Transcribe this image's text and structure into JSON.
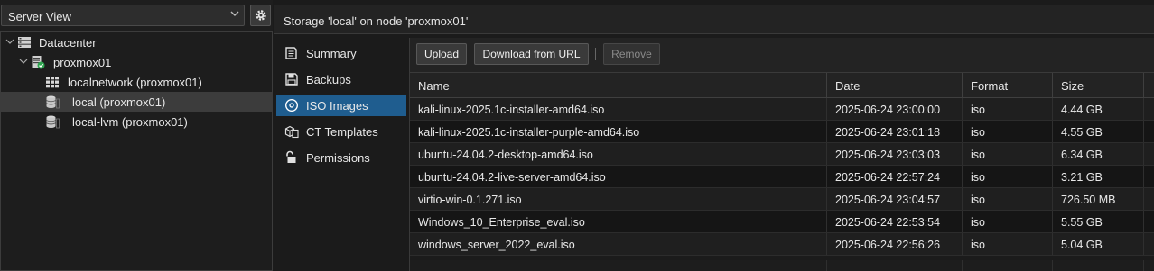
{
  "colors": {
    "accent": "#1f5d8f",
    "status_ok": "#2ea44f"
  },
  "view_selector": {
    "value": "Server View",
    "icon": "chevron-down-icon"
  },
  "gear": {
    "icon": "gear-icon"
  },
  "tree": [
    {
      "label": "Datacenter",
      "icon": "datacenter-icon"
    },
    {
      "label": "proxmox01",
      "icon": "server-online-icon"
    },
    {
      "label": "localnetwork (proxmox01)",
      "icon": "network-grid-icon"
    },
    {
      "label": "local (proxmox01)",
      "icon": "storage-icon",
      "selected": true
    },
    {
      "label": "local-lvm (proxmox01)",
      "icon": "storage-icon"
    }
  ],
  "panel_title": "Storage 'local' on node 'proxmox01'",
  "nav": [
    {
      "label": "Summary",
      "icon": "book-icon"
    },
    {
      "label": "Backups",
      "icon": "floppy-icon"
    },
    {
      "label": "ISO Images",
      "icon": "disc-icon",
      "active": true
    },
    {
      "label": "CT Templates",
      "icon": "cube-file-icon"
    },
    {
      "label": "Permissions",
      "icon": "unlock-icon"
    }
  ],
  "toolbar": {
    "upload": "Upload",
    "download": "Download from URL",
    "remove": "Remove"
  },
  "columns": [
    "Name",
    "Date",
    "Format",
    "Size"
  ],
  "rows": [
    {
      "name": "kali-linux-2025.1c-installer-amd64.iso",
      "date": "2025-06-24 23:00:00",
      "format": "iso",
      "size": "4.44 GB"
    },
    {
      "name": "kali-linux-2025.1c-installer-purple-amd64.iso",
      "date": "2025-06-24 23:01:18",
      "format": "iso",
      "size": "4.55 GB"
    },
    {
      "name": "ubuntu-24.04.2-desktop-amd64.iso",
      "date": "2025-06-24 23:03:03",
      "format": "iso",
      "size": "6.34 GB"
    },
    {
      "name": "ubuntu-24.04.2-live-server-amd64.iso",
      "date": "2025-06-24 22:57:24",
      "format": "iso",
      "size": "3.21 GB"
    },
    {
      "name": "virtio-win-0.1.271.iso",
      "date": "2025-06-24 23:04:57",
      "format": "iso",
      "size": "726.50 MB"
    },
    {
      "name": "Windows_10_Enterprise_eval.iso",
      "date": "2025-06-24 22:53:54",
      "format": "iso",
      "size": "5.55 GB"
    },
    {
      "name": "windows_server_2022_eval.iso",
      "date": "2025-06-24 22:56:26",
      "format": "iso",
      "size": "5.04 GB"
    }
  ]
}
